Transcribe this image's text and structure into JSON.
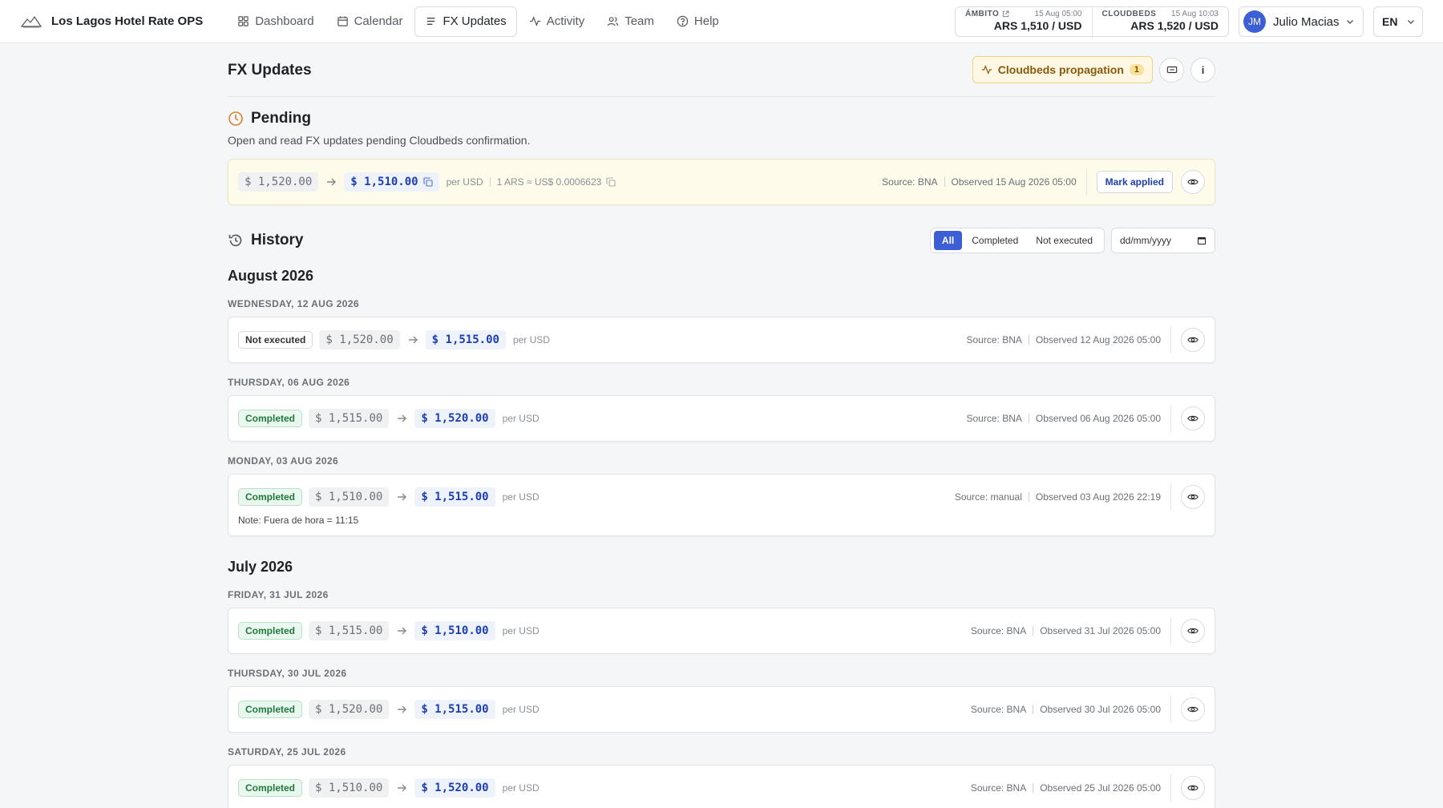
{
  "app": {
    "name": "Los Lagos Hotel Rate OPS"
  },
  "nav": [
    {
      "label": "Dashboard",
      "icon": "grid-icon"
    },
    {
      "label": "Calendar",
      "icon": "calendar-icon"
    },
    {
      "label": "FX Updates",
      "icon": "list-icon"
    },
    {
      "label": "Activity",
      "icon": "activity-icon"
    },
    {
      "label": "Team",
      "icon": "users-icon"
    },
    {
      "label": "Help",
      "icon": "help-icon"
    }
  ],
  "rates": {
    "ambito": {
      "label": "ÁMBITO",
      "time": "15 Aug 05:00",
      "value": "ARS 1,510 / USD"
    },
    "cloudbeds": {
      "label": "CLOUDBEDS",
      "time": "15 Aug 10:03",
      "value": "ARS 1,520 / USD"
    }
  },
  "user": {
    "initials": "JM",
    "name": "Julio Macias"
  },
  "lang": "EN",
  "page": {
    "title": "FX Updates",
    "propagation_label": "Cloudbeds propagation",
    "propagation_count": "1",
    "info_label": "i"
  },
  "pending": {
    "title": "Pending",
    "description": "Open and read FX updates pending Cloudbeds confirmation.",
    "old": "$ 1,520.00",
    "new": "$ 1,510.00",
    "per": "per USD",
    "inverse": "1 ARS ≈ US$ 0.0006623",
    "source": "Source: BNA",
    "observed": "Observed 15 Aug 2026 05:00",
    "mark_label": "Mark applied"
  },
  "history": {
    "title": "History",
    "filters": [
      "All",
      "Completed",
      "Not executed"
    ],
    "date_placeholder": "dd/mm/yyyy",
    "months": [
      {
        "title": "August 2026",
        "days": [
          {
            "day": "WEDNESDAY, 12 AUG 2026",
            "status": "Not executed",
            "old": "$ 1,520.00",
            "new": "$ 1,515.00",
            "per": "per USD",
            "source": "Source: BNA",
            "observed": "Observed 12 Aug 2026 05:00",
            "note": ""
          },
          {
            "day": "THURSDAY, 06 AUG 2026",
            "status": "Completed",
            "old": "$ 1,515.00",
            "new": "$ 1,520.00",
            "per": "per USD",
            "source": "Source: BNA",
            "observed": "Observed 06 Aug 2026 05:00",
            "note": ""
          },
          {
            "day": "MONDAY, 03 AUG 2026",
            "status": "Completed",
            "old": "$ 1,510.00",
            "new": "$ 1,515.00",
            "per": "per USD",
            "source": "Source: manual",
            "observed": "Observed 03 Aug 2026 22:19",
            "note": "Note: Fuera de hora = 11:15"
          }
        ]
      },
      {
        "title": "July 2026",
        "days": [
          {
            "day": "FRIDAY, 31 JUL 2026",
            "status": "Completed",
            "old": "$ 1,515.00",
            "new": "$ 1,510.00",
            "per": "per USD",
            "source": "Source: BNA",
            "observed": "Observed 31 Jul 2026 05:00",
            "note": ""
          },
          {
            "day": "THURSDAY, 30 JUL 2026",
            "status": "Completed",
            "old": "$ 1,520.00",
            "new": "$ 1,515.00",
            "per": "per USD",
            "source": "Source: BNA",
            "observed": "Observed 30 Jul 2026 05:00",
            "note": ""
          },
          {
            "day": "SATURDAY, 25 JUL 2026",
            "status": "Completed",
            "old": "$ 1,510.00",
            "new": "$ 1,520.00",
            "per": "per USD",
            "source": "Source: BNA",
            "observed": "Observed 25 Jul 2026 05:00",
            "note": ""
          }
        ]
      }
    ]
  },
  "colors": {
    "accent": "#3d5fd6",
    "completed": "#1f7a3d",
    "pending_bg": "#fefbea",
    "propagation": "#8a5a0b"
  }
}
